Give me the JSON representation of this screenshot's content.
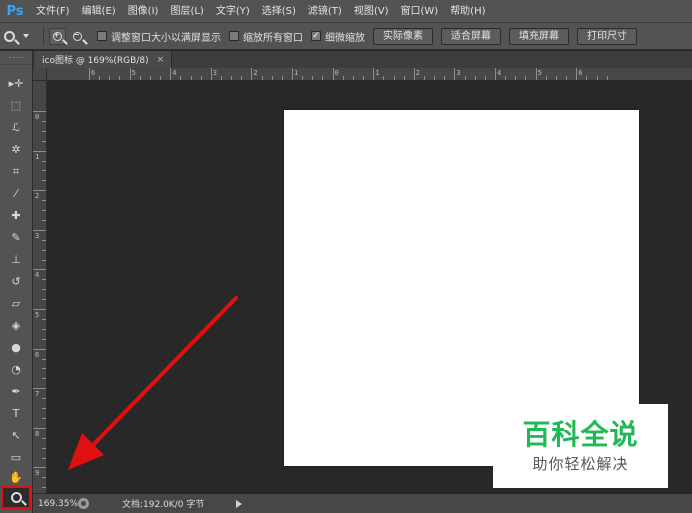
{
  "app": {
    "logo": "Ps"
  },
  "menu": [
    {
      "label": "文件(F)"
    },
    {
      "label": "编辑(E)"
    },
    {
      "label": "图像(I)"
    },
    {
      "label": "图层(L)"
    },
    {
      "label": "文字(Y)"
    },
    {
      "label": "选择(S)"
    },
    {
      "label": "滤镜(T)"
    },
    {
      "label": "视图(V)"
    },
    {
      "label": "窗口(W)"
    },
    {
      "label": "帮助(H)"
    }
  ],
  "options": {
    "zoom_in_glyph": "+",
    "zoom_out_glyph": "−",
    "checkboxes": [
      {
        "label": "调整窗口大小以满屏显示",
        "checked": false,
        "mark": ""
      },
      {
        "label": "缩放所有窗口",
        "checked": false,
        "mark": ""
      },
      {
        "label": "细微缩放",
        "checked": true,
        "mark": "✓"
      }
    ],
    "buttons": [
      {
        "label": "实际像素"
      },
      {
        "label": "适合屏幕"
      },
      {
        "label": "填充屏幕"
      },
      {
        "label": "打印尺寸"
      }
    ]
  },
  "document": {
    "tab_title": "ico图标 @ 169%(RGB/8)",
    "tab_close": "×"
  },
  "rulers": {
    "horizontal_labels": [
      "6",
      "5",
      "4",
      "3",
      "2",
      "1",
      "0",
      "1",
      "2",
      "3",
      "4",
      "5",
      "6"
    ],
    "vertical_labels": [
      "0",
      "1",
      "2",
      "3",
      "4",
      "5",
      "6",
      "7",
      "8",
      "9"
    ]
  },
  "tools": [
    {
      "name": "move-tool-icon",
      "glyph": "▸✛"
    },
    {
      "name": "marquee-tool-icon",
      "glyph": "⬚"
    },
    {
      "name": "lasso-tool-icon",
      "glyph": "ℒ"
    },
    {
      "name": "magic-wand-tool-icon",
      "glyph": "✲"
    },
    {
      "name": "crop-tool-icon",
      "glyph": "⌗"
    },
    {
      "name": "eyedropper-tool-icon",
      "glyph": "⁄"
    },
    {
      "name": "healing-brush-tool-icon",
      "glyph": "✚"
    },
    {
      "name": "brush-tool-icon",
      "glyph": "✎"
    },
    {
      "name": "clone-stamp-tool-icon",
      "glyph": "⊥"
    },
    {
      "name": "history-brush-tool-icon",
      "glyph": "↺"
    },
    {
      "name": "eraser-tool-icon",
      "glyph": "▱"
    },
    {
      "name": "paint-bucket-tool-icon",
      "glyph": "◈"
    },
    {
      "name": "blur-tool-icon",
      "glyph": "●"
    },
    {
      "name": "dodge-tool-icon",
      "glyph": "◔"
    },
    {
      "name": "pen-tool-icon",
      "glyph": "✒"
    },
    {
      "name": "type-tool-icon",
      "glyph": "T"
    },
    {
      "name": "path-selection-tool-icon",
      "glyph": "↖"
    },
    {
      "name": "rectangle-tool-icon",
      "glyph": "▭"
    },
    {
      "name": "hand-tool-icon",
      "glyph": "✋"
    }
  ],
  "status": {
    "zoom": "169.35%",
    "doc_info": "文档:192.0K/0 字节"
  },
  "watermark": {
    "title": "百科全说",
    "subtitle": "助你轻松解决"
  },
  "colors": {
    "accent_red": "#e01010",
    "watermark_green": "#20b955",
    "ps_blue": "#31a8ff"
  }
}
